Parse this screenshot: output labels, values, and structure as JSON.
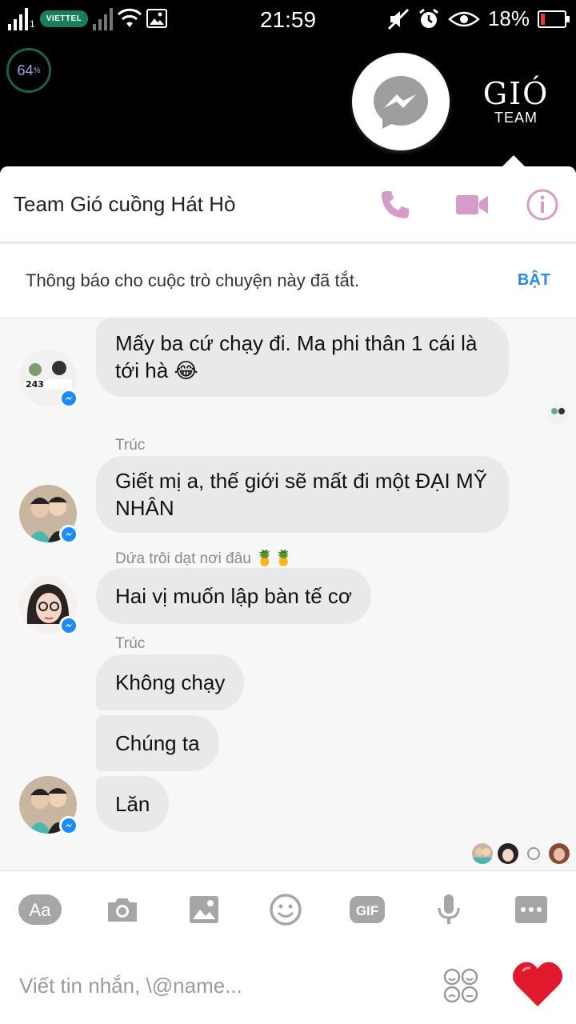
{
  "status_bar": {
    "carrier": "VIETTEL",
    "sim_slot": "1",
    "time": "21:59",
    "battery_percent": "18%",
    "battery_level": 0.18
  },
  "overlay": {
    "memory_percent": "64",
    "memory_unit": "%",
    "team_logo_text": "GIÓ",
    "team_logo_sub": "TEAM"
  },
  "chat": {
    "title": "Team Gió cuồng Hát Hò",
    "notice_text": "Thông báo cho cuộc trò chuyện này đã tắt.",
    "notice_action": "BẬT"
  },
  "messages": {
    "m1": "Mấy ba cứ chạy đi. Ma phi thân 1 cái là tới hà 😂",
    "sender2": "Trúc",
    "m2": "Giết mị a, thế giới sẽ mất đi một ĐẠI MỸ NHÂN",
    "sender3": "Dứa trôi dạt nơi đâu 🍍🍍",
    "m3": "Hai vị muốn lập bàn tế cơ",
    "sender4": "Trúc",
    "m4a": "Không chạy",
    "m4b": "Chúng ta",
    "m4c": "Lăn"
  },
  "composer": {
    "placeholder": "Viết tin nhắn, \\@name...",
    "text_icon_label": "Aa",
    "gif_label": "GIF"
  },
  "colors": {
    "accent_pink": "#d59bc9",
    "link_blue": "#2d88e0",
    "bubble_gray": "#e9e9eb",
    "icon_gray": "#9e9e9e"
  }
}
